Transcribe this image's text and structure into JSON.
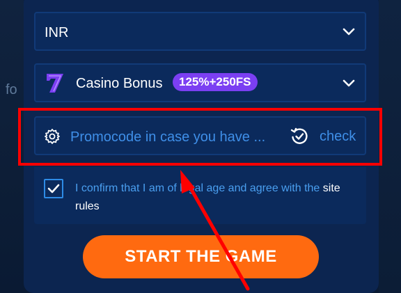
{
  "background": {
    "partial_text": "fo"
  },
  "currency": {
    "value": "INR"
  },
  "bonus": {
    "label": "Casino Bonus",
    "badge": "125%+250FS"
  },
  "promo": {
    "placeholder": "Promocode in case you have ...",
    "check_label": "check"
  },
  "confirm": {
    "text": "I confirm that I am of legal age and agree with the ",
    "link": "site rules",
    "checked": true
  },
  "cta": {
    "label": "START THE GAME"
  },
  "colors": {
    "accent": "#3f8fe8",
    "button": "#ff6a10",
    "badge": "#7b3ff2",
    "highlight": "#ff0000"
  }
}
